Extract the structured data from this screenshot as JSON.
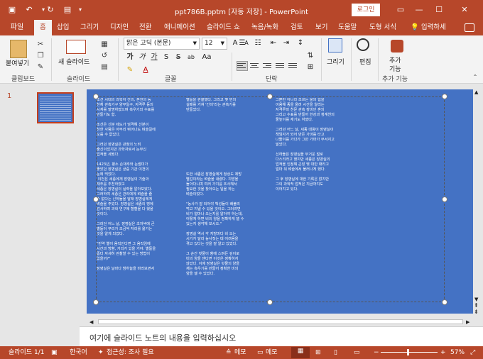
{
  "titlebar": {
    "title": "ppt786B.pptm [자동 저장] - PowerPoint",
    "login_label": "로그인",
    "save_icon": "save-icon",
    "undo_icon": "undo-icon",
    "redo_icon": "redo-icon",
    "present_icon": "present-from-start-icon",
    "restore_icon": "ribbon-display-icon",
    "minimize_icon": "minimize-icon",
    "maximize_icon": "maximize-icon",
    "close_icon": "close-icon"
  },
  "tabs": {
    "file": "파일",
    "items": [
      "홈",
      "삽입",
      "그리기",
      "디자인",
      "전환",
      "애니메이션",
      "슬라이드 쇼",
      "녹음/녹화",
      "검토",
      "보기",
      "도움말",
      "도형 서식"
    ],
    "active": "홈",
    "tell_me": "입력하세",
    "tell_me_icon": "lightbulb-icon"
  },
  "ribbon": {
    "clipboard": {
      "paste": "붙여넣기",
      "label": "클립보드"
    },
    "slides": {
      "new_slide": "새 슬라이드",
      "label": "슬라이드"
    },
    "font": {
      "name": "맑은 고딕 (본문)",
      "size": "12",
      "bold": "가",
      "italic": "가",
      "underline": "가",
      "strike": "S",
      "shadow": "ab",
      "label": "글꼴"
    },
    "paragraph": {
      "label": "단락"
    },
    "drawing": {
      "draw": "그리기"
    },
    "editing": {
      "edit": "편집"
    },
    "addins": {
      "add": "추가",
      "add2": "기능",
      "label": "추가 기능"
    }
  },
  "thumbnail": {
    "number": "1"
  },
  "slide": {
    "col1": "조선 시대의 과학자 간의, 혼천의 등\n천체 관측기구 양부일구, 자격루 등의\n시계를 발명하였으며 측우기와 수표를\n만들기도 함.\n\n조선은 신분 제도가 엄격해 신분이\n천한 사람은 아무리 뛰어나도 벼슬길에\n오를 수 없었다.\n\n그러던 장영실은 관청의 노비\n출신이었지만 과학자로서 눈부신\n업적을 세웠다.\n\n1423년, 평소 손재주와 눈썰미가\n좋았던 장영실은 궁중 기관 이천의\n눈에 띄었다.\n 이천은 세종에게 장영실의 기술과\n재주를 추천하였고\n세종은 장영실의 실력을 알아보았다.\n그러하여 세종은 관리에게 벼슬을 줄\n수 없다는 신하들을 달래 장영실에게\n벼슬을 주었다. 장영실은 세종의 명에\n감사하며 과학 연구에 혈혈을 다 했을\n것이다.\n\n그러던 어느 날, 장영실은 초저녁에 큰\n별들이 무리가 조금씩 자리를 옮기는\n것을 알게 되었다.\n\n\"만약 별이 움직인다면 그 움직임에\n시간과 방향, 거리가 있을 거야. 별들을\n좀더 자세히 관찰할 수 있는 방법이\n없을까?\"\n\n장영실은 날마다 밤하늘을 바라보면서",
    "col2": "별들을 관찰했다. 그리고 몇 번의\n실패를 거쳐 '간의'라는 관측기를\n만들었다.\n\n\n\n\n\n\n\n\n\n\n\n\n또한 세종은 장영실에게 정상도 제방\n별갑이라는 벼슬을 내렸다. 지방을\n돌아다니며 여러 가지를 조사해서\n필요한 것을 찾아오는 일을 하는\n벼슬이었다.\n\n\"농사가 잘 되어야 백성들이 배불리\n먹고 지낼 수 있을 것이오. 그러려면\n비가 얼마나 오는지를 알아야 하는데,\n어떻게 하면 비의 양을 정확하게 잴 수\n있는지 생각해 보시오.\"\n\n장영실 역시 각 지방마다 비 오는\n시기가 달라 농사짓는 데 어려움을\n겪고 있다는 것을 잘 알고 있었다.\n\n그 순간 빗물이 항에 스며든 깊이로\n비의 양을 잰다면 이것은 정확하지\n않았다. 이에 장영실은 빗물의 양을\n재는 측우기를 만들어 정확한 비의\n양을 잴 수 있었다.",
    "col3": "그뿐만 아니라 조르는 물의 힘을\n이용해 종을 울려 시간을 알리는\n자격루와 천문 관측 장비인 혼의\n그리고 수표를 만들어 한강과 청계천의\n물높이를 재기도 하였다.\n\n그러던 어느 날, 세종 대왕이 장영실이\n책임자가 되어 만든 가마를 타고\n나들이를 가다가 그만 가마가 부서지고\n말았다.\n\n신하들은 장영실을 무거운 벌로\n다스리라고 했지만 세종은 장영실의\n업적을 인정해 곤장 몇 대만 때리고\n얼마 뒤 벼슬에서 물러나게 했다.\n\n그 후 장영실에 대한 기록은 없지만\n그의 과학적 업적은 지금까지도\n이어지고 있다."
  },
  "notes": {
    "placeholder": "여기에 슬라이드 노트의 내용을 입력하십시오"
  },
  "status": {
    "slide": "슬라이드 1/1",
    "language": "한국어",
    "accessibility": "접근성: 조사 필요",
    "notes": "메모",
    "comments": "메모",
    "zoom": "57%"
  }
}
